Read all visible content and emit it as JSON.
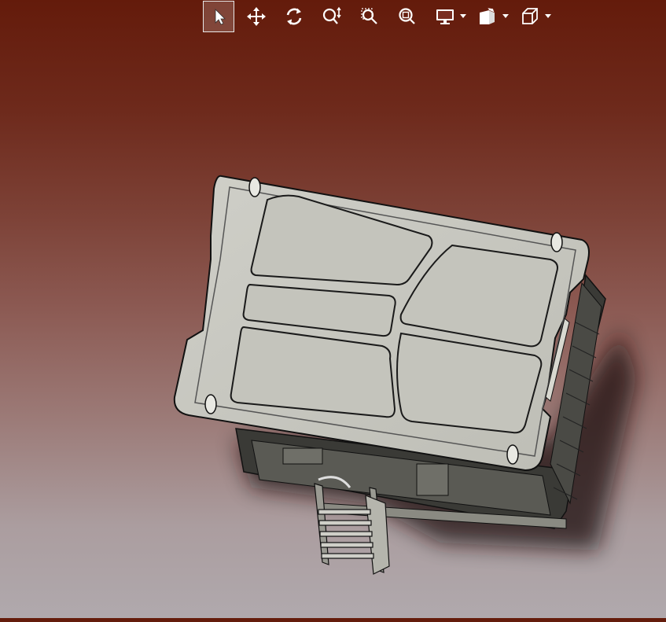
{
  "toolbar": {
    "tools": [
      {
        "icon": "select-arrow-icon",
        "active": true
      },
      {
        "icon": "pan-icon"
      },
      {
        "icon": "rotate-icon"
      },
      {
        "icon": "zoom-in-out-icon"
      },
      {
        "icon": "zoom-to-area-icon"
      },
      {
        "icon": "zoom-to-fit-icon"
      },
      {
        "icon": "display-style-icon",
        "dropdown": true
      },
      {
        "icon": "view-orientation-icon",
        "dropdown": true
      },
      {
        "icon": "standard-views-cube-icon",
        "dropdown": true
      }
    ]
  },
  "viewport": {
    "model": "3d-box-with-ladder"
  }
}
